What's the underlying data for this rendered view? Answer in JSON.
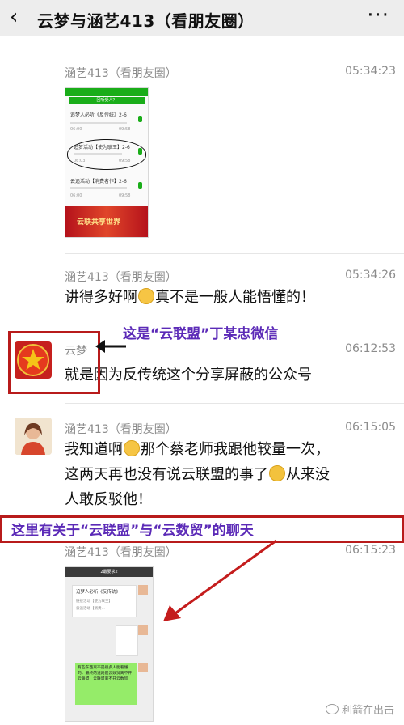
{
  "header": {
    "back_icon": "chevron-left",
    "title": "云梦与涵艺413（看朋友圈）",
    "more_icon": "more-dots"
  },
  "messages": [
    {
      "sender": "涵艺413（看朋友圈）",
      "time": "05:34:23"
    },
    {
      "sender": "涵艺413（看朋友圈）",
      "time": "05:34:26",
      "text_a": "讲得多好啊",
      "text_b": "真不是一般人能悟懂的！"
    },
    {
      "sender": "云梦",
      "time": "06:12:53",
      "text": "就是因为反传统这个分享屏蔽的公众号"
    },
    {
      "sender": "涵艺413（看朋友圈）",
      "time": "06:15:05",
      "line1_a": "我知道啊",
      "line1_b": "那个蔡老师我跟他较量一次，",
      "line2_a": "这两天再也没有说云联盟的事了",
      "line2_b": "从来没",
      "line3": "人敢反驳他！"
    },
    {
      "sender": "涵艺413（看朋友圈）",
      "time": "06:15:23"
    }
  ],
  "thumb1": {
    "header": "回听受人？",
    "subheader": "...",
    "items": [
      "追梦人必听《反传统》2-6",
      "追梦活动【使为联王】2-6",
      "云追活动【消费者作】2-6"
    ],
    "times": [
      "06:00",
      "06:03",
      "06:00"
    ],
    "durations": [
      "09:58",
      "09:58",
      "09:58"
    ],
    "banner_text": "云联共享世界"
  },
  "thumb2": {
    "title": "2最要求2",
    "card_title": "追梦人必听《反传统》",
    "card_lines": [
      "链接活动【使为联王】",
      "云追活动【消费..."
    ],
    "green_text": "有些东西离不是很多人能看懂的，最终的道路是云数贸离不开云联盟，云联盟离不开云数贸"
  },
  "annotations": {
    "avatar_note": "这是“云联盟”丁某忠微信",
    "chat_note": "这里有关于“云联盟”与“云数贸”的聊天"
  },
  "watermark": "利箭在出击",
  "colors": {
    "annotation_red": "#b81b1b",
    "annotation_purple": "#5b2ab7",
    "wechat_green": "#1aad19"
  }
}
